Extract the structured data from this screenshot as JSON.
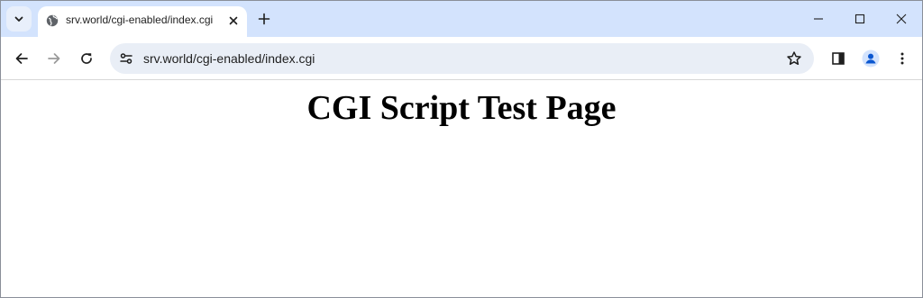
{
  "browser": {
    "tab": {
      "title": "srv.world/cgi-enabled/index.cgi"
    },
    "address_bar": {
      "url": "srv.world/cgi-enabled/index.cgi"
    }
  },
  "icons": {
    "tab_search": "chevron-down-icon",
    "favicon": "globe-icon",
    "tab_close": "close-icon",
    "new_tab": "plus-icon",
    "minimize": "minimize-icon",
    "maximize": "maximize-icon",
    "close_window": "close-icon",
    "back": "arrow-left-icon",
    "forward": "arrow-right-icon",
    "reload": "reload-icon",
    "site_info": "tune-icon",
    "bookmark": "star-icon",
    "side_panel": "side-panel-icon",
    "profile": "avatar-icon",
    "menu": "kebab-menu-icon"
  },
  "colors": {
    "tabstrip": "#d3e3fd",
    "omnibox": "#e9eef6",
    "profile_accent": "#0b57d0"
  },
  "page": {
    "heading": "CGI Script Test Page"
  }
}
